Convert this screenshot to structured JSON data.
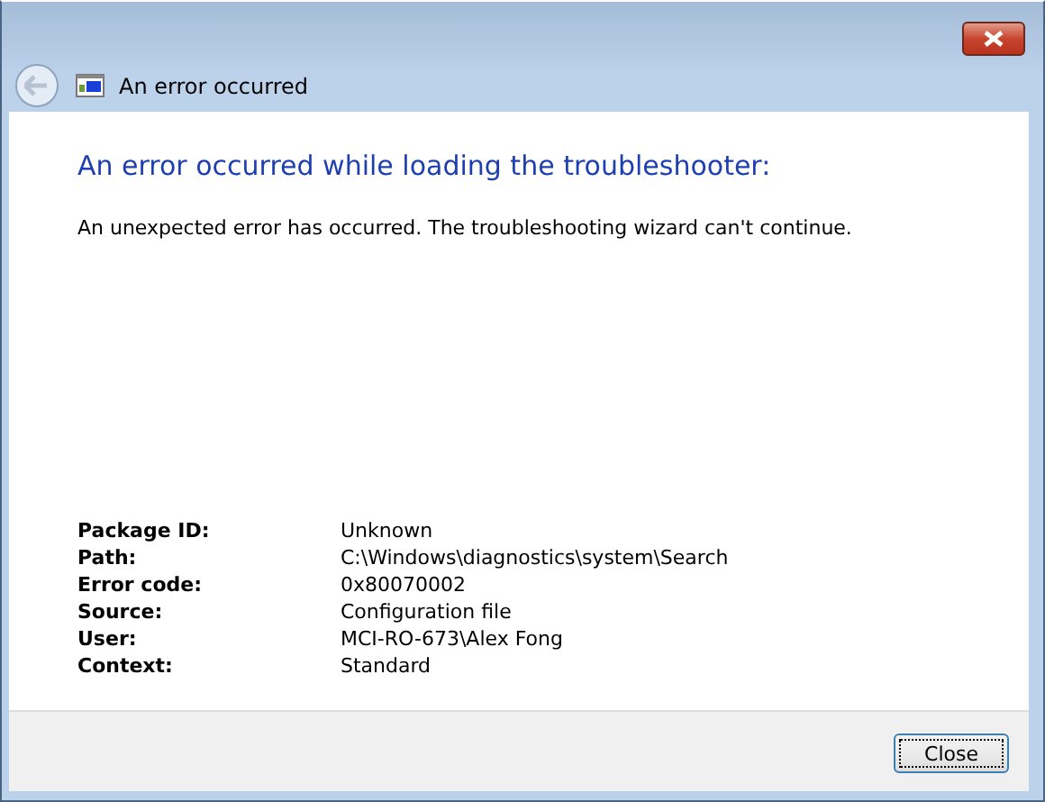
{
  "window": {
    "title": "An error occurred"
  },
  "heading": "An error occurred while loading the troubleshooter:",
  "message": "An unexpected error has occurred. The troubleshooting wizard can't continue.",
  "details": [
    {
      "label": "Package ID:",
      "value": "Unknown"
    },
    {
      "label": "Path:",
      "value": "C:\\Windows\\diagnostics\\system\\Search"
    },
    {
      "label": "Error code:",
      "value": "0x80070002"
    },
    {
      "label": "Source:",
      "value": "Configuration file"
    },
    {
      "label": "User:",
      "value": "MCI-RO-673\\Alex Fong"
    },
    {
      "label": "Context:",
      "value": "Standard"
    }
  ],
  "buttons": [
    "Close"
  ]
}
